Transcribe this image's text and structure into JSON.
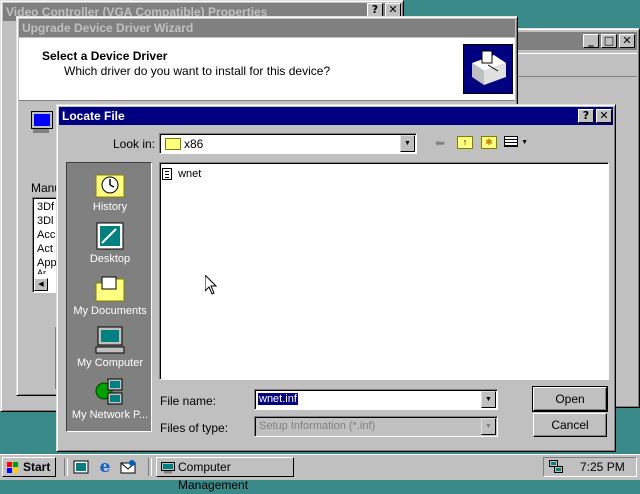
{
  "background_window": {
    "title": "Video Controller (VGA Compatible) Properties",
    "help_button": "?",
    "close_button": "✕"
  },
  "right_window": {
    "min_button": "_",
    "max_button": "□",
    "close_button": "✕"
  },
  "wizard": {
    "title": "Upgrade Device Driver Wizard",
    "heading": "Select a Device Driver",
    "subheading": "Which driver do you want to install for this device?",
    "manufacturer_label": "Manu",
    "list_items": [
      "3Df",
      "3Dl",
      "Acc",
      "Act",
      "App",
      "Ar"
    ]
  },
  "locate_file": {
    "title": "Locate File",
    "help_button": "?",
    "close_button": "✕",
    "look_in_label": "Look in:",
    "look_in_value": "x86",
    "places": [
      {
        "label": "History",
        "icon": "history-icon"
      },
      {
        "label": "Desktop",
        "icon": "desktop-icon"
      },
      {
        "label": "My Documents",
        "icon": "my-documents-icon"
      },
      {
        "label": "My Computer",
        "icon": "my-computer-icon"
      },
      {
        "label": "My Network P...",
        "icon": "my-network-places-icon"
      }
    ],
    "files": [
      {
        "name": "wnet",
        "icon": "inf-file-icon"
      }
    ],
    "file_name_label": "File name:",
    "file_name_value": "wnet.inf",
    "files_of_type_label": "Files of type:",
    "files_of_type_value": "Setup Information (*.inf)",
    "open_button": "Open",
    "cancel_button": "Cancel"
  },
  "taskbar": {
    "start_label": "Start",
    "task_label": "Computer Management",
    "clock": "7:25 PM"
  },
  "colors": {
    "desktop": "#3a8a8a",
    "active_title": "#000080",
    "inactive_title": "#808080",
    "places_bar": "#808080"
  }
}
